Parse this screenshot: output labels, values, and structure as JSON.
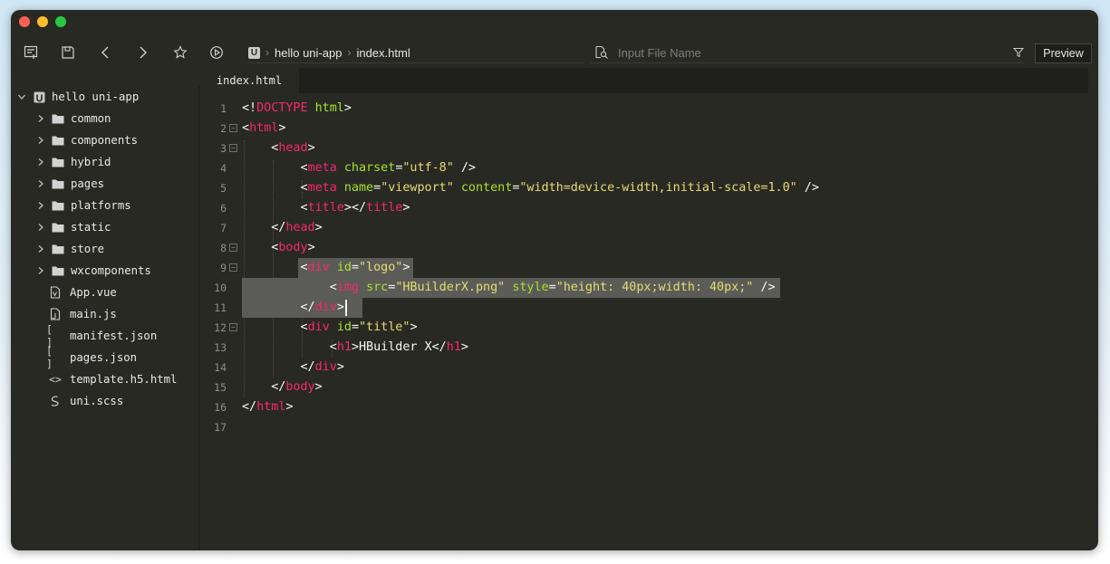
{
  "window": {
    "traffic_lights": [
      "close",
      "minimize",
      "maximize"
    ]
  },
  "toolbar": {
    "icons": [
      "new-file-icon",
      "save-icon",
      "back-icon",
      "forward-icon",
      "favorite-icon",
      "run-icon"
    ],
    "breadcrumb": {
      "logo_text": "U",
      "items": [
        "hello uni-app",
        "index.html"
      ]
    },
    "search": {
      "placeholder": "Input File Name",
      "value": ""
    },
    "preview_label": "Preview"
  },
  "sidebar": {
    "project": {
      "name": "hello uni-app",
      "expanded": true
    },
    "folders": [
      "common",
      "components",
      "hybrid",
      "pages",
      "platforms",
      "static",
      "store",
      "wxcomponents"
    ],
    "files": [
      {
        "name": "App.vue",
        "icon": "vue-file-icon"
      },
      {
        "name": "main.js",
        "icon": "js-file-icon"
      },
      {
        "name": "manifest.json",
        "icon": "json-file-icon",
        "glyph": "[ ]"
      },
      {
        "name": "pages.json",
        "icon": "json-file-icon",
        "glyph": "[ ]"
      },
      {
        "name": "template.h5.html",
        "icon": "html-file-icon",
        "glyph": "<>"
      },
      {
        "name": "uni.scss",
        "icon": "scss-file-icon"
      }
    ]
  },
  "editor": {
    "active_tab": "index.html",
    "line_count": 17,
    "lines": [
      "<!DOCTYPE html>",
      "<html>",
      "    <head>",
      "        <meta charset=\"utf-8\" />",
      "        <meta name=\"viewport\" content=\"width=device-width,initial-scale=1.0\" />",
      "        <title></title>",
      "    </head>",
      "    <body>",
      "        <div id=\"logo\">",
      "            <img src=\"HBuilderX.png\" style=\"height: 40px;width: 40px;\" />",
      "        </div>",
      "        <div id=\"title\">",
      "            <h1>HBuilder X</h1>",
      "        </div>",
      "    </body>",
      "</html>",
      ""
    ],
    "foldable_lines": [
      2,
      3,
      8,
      9,
      12
    ],
    "selected_lines": [
      9,
      10,
      11
    ],
    "cursor_line": 11
  },
  "colors": {
    "background": "#282923",
    "tag": "#f92672",
    "attribute": "#a6e22e",
    "string": "#e6db74",
    "text": "#f8f8f2",
    "line_number": "#8f908a",
    "selection": "#5b5c57"
  }
}
